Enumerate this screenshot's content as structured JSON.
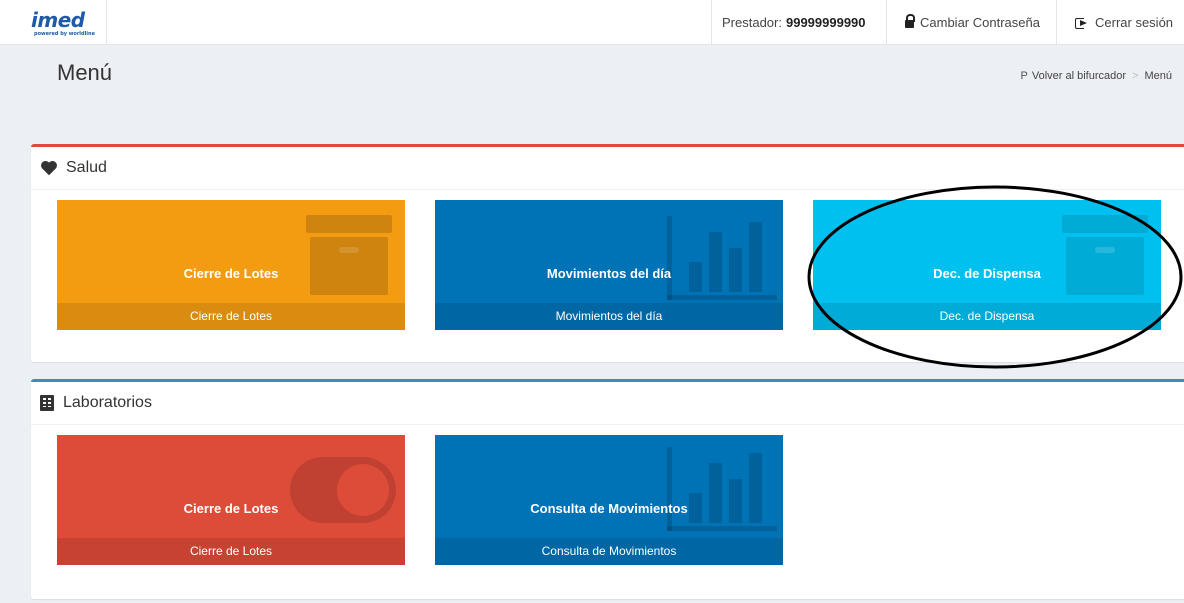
{
  "header": {
    "logo_text": "imed",
    "logo_sub": "powered by worldline",
    "provider_label": "Prestador:",
    "provider_value": "99999999990",
    "change_password": "Cambiar Contraseña",
    "logout": "Cerrar sesión"
  },
  "page": {
    "title": "Menú",
    "breadcrumb": {
      "back_label": "Volver al bifurcador",
      "separator": ">",
      "current": "Menú"
    }
  },
  "sections": [
    {
      "title": "Salud",
      "accent": "#dd4b39",
      "icon": "heart-icon",
      "tiles": [
        {
          "title": "Cierre de Lotes",
          "footer": "Cierre de Lotes",
          "color": "#f39c12",
          "icon": "archive-icon"
        },
        {
          "title": "Movimientos del día",
          "footer": "Movimientos del día",
          "color": "#0073b7",
          "icon": "bar-chart-icon"
        },
        {
          "title": "Dec. de Dispensa",
          "footer": "Dec. de Dispensa",
          "color": "#00c0ef",
          "icon": "archive-icon"
        }
      ]
    },
    {
      "title": "Laboratorios",
      "accent": "#3c8dbc",
      "icon": "building-icon",
      "tiles": [
        {
          "title": "Cierre de Lotes",
          "footer": "Cierre de Lotes",
          "color": "#dd4b39",
          "icon": "toggle-icon"
        },
        {
          "title": "Consulta de Movimientos",
          "footer": "Consulta de Movimientos",
          "color": "#0073b7",
          "icon": "bar-chart-icon"
        }
      ]
    }
  ]
}
